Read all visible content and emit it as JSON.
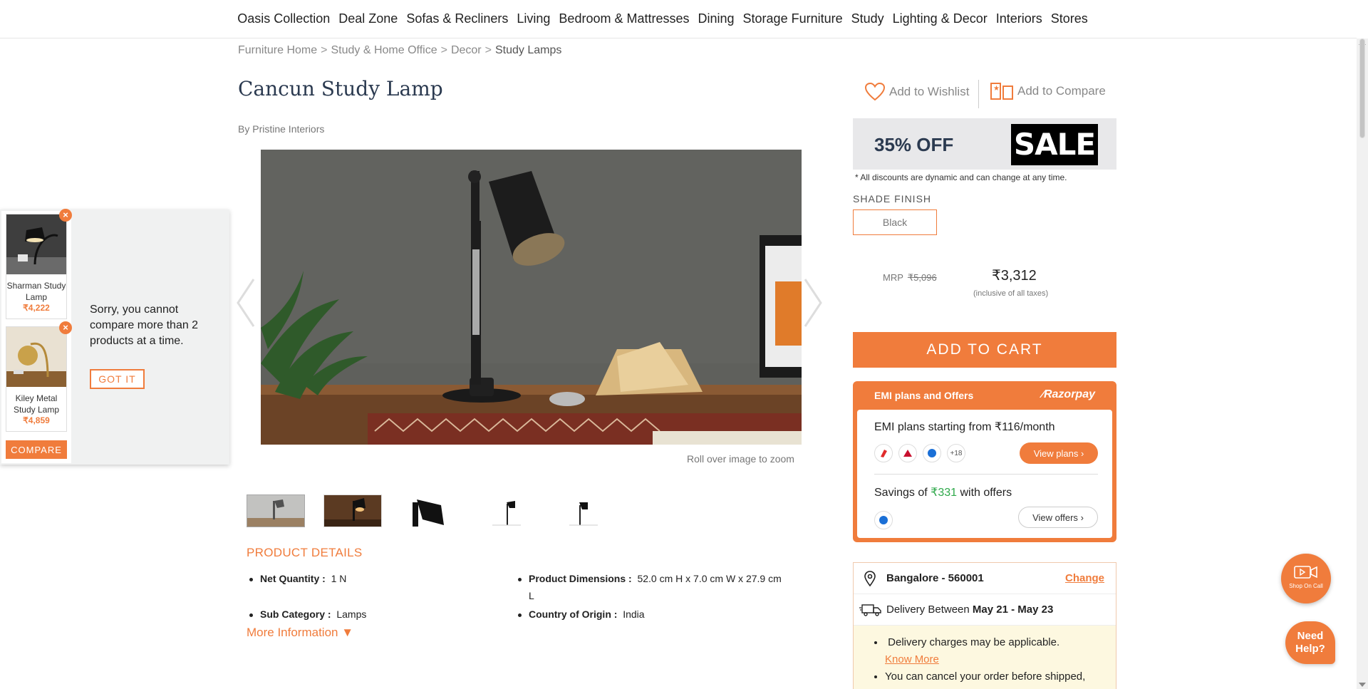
{
  "nav": {
    "items": [
      "Oasis Collection",
      "Deal Zone",
      "Sofas & Recliners",
      "Living",
      "Bedroom & Mattresses",
      "Dining",
      "Storage Furniture",
      "Study",
      "Lighting & Decor",
      "Interiors",
      "Stores"
    ]
  },
  "breadcrumb": {
    "items": [
      "Furniture Home",
      "Study & Home Office",
      "Decor",
      "Study Lamps"
    ],
    "separator": ">"
  },
  "product": {
    "title": "Cancun Study Lamp",
    "brand": "By Pristine Interiors",
    "zoom_hint": "Roll over image to zoom"
  },
  "details": {
    "title": "PRODUCT DETAILS",
    "net_quantity_label": "Net Quantity :",
    "net_quantity_value": "1 N",
    "dimensions_label": "Product Dimensions :",
    "dimensions_value": "52.0 cm H x 7.0 cm W x 27.9 cm",
    "dimensions_value_cont": "L",
    "subcategory_label": "Sub Category :",
    "subcategory_value": "Lamps",
    "origin_label": "Country of Origin :",
    "origin_value": "India",
    "more_info": "More Information ▼"
  },
  "compare_widget": {
    "items": [
      {
        "name": "Sharman Study Lamp",
        "price": "₹4,222"
      },
      {
        "name": "Kiley Metal Study Lamp",
        "price": "₹4,859"
      }
    ],
    "compare_label": "COMPARE",
    "message": "Sorry, you cannot compare more than 2 products at a time.",
    "got_it": "GOT IT"
  },
  "actions": {
    "wishlist": "Add to Wishlist",
    "compare": "Add to Compare"
  },
  "offer": {
    "discount": "35% OFF",
    "sale_tag": "SALE",
    "disclaimer": "* All discounts are dynamic and can change at any time."
  },
  "finish": {
    "label": "SHADE FINISH",
    "selected": "Black"
  },
  "pricing": {
    "mrp_label": "MRP",
    "mrp": "₹5,096",
    "price": "₹3,312",
    "note": "(inclusive of all taxes)",
    "add_to_cart": "ADD TO CART"
  },
  "emi": {
    "header": "EMI plans and Offers",
    "provider": "Razorpay",
    "plans_text": "EMI plans starting from ₹116/month",
    "more_banks": "+18",
    "view_plans": "View plans",
    "savings_prefix": "Savings of ",
    "savings_amount": "₹331",
    "savings_suffix": " with offers",
    "view_offers": "View offers"
  },
  "delivery": {
    "location": "Bangalore - 560001",
    "change": "Change",
    "between_label": "Delivery Between ",
    "dates": "May 21 - May 23",
    "note1": "Delivery charges may be applicable.",
    "know_more": "Know More",
    "note2": "You can cancel your order before shipped, and a full refund will be initiated."
  },
  "fabs": {
    "video_label": "Shop On Call",
    "help": "Need Help?"
  },
  "colors": {
    "accent": "#f07c3c",
    "title": "#2b3a50",
    "savings": "#2ea84a"
  }
}
